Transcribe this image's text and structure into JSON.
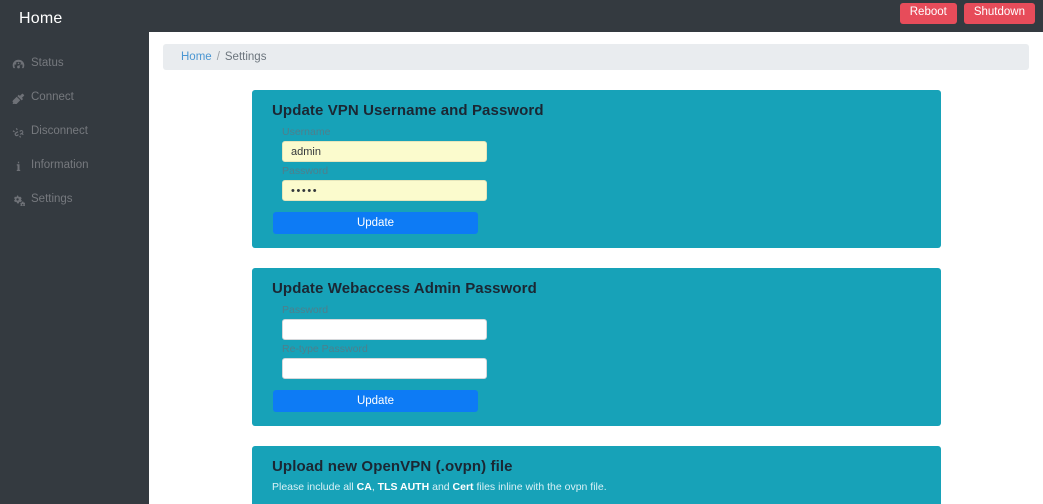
{
  "header": {
    "brand": "Home",
    "reboot_label": "Reboot",
    "shutdown_label": "Shutdown"
  },
  "sidebar": {
    "items": [
      {
        "label": "Status",
        "icon": "dashboard-icon"
      },
      {
        "label": "Connect",
        "icon": "plug-icon"
      },
      {
        "label": "Disconnect",
        "icon": "broken-chain-icon"
      },
      {
        "label": "Information",
        "icon": "info-icon"
      },
      {
        "label": "Settings",
        "icon": "gears-icon"
      }
    ]
  },
  "breadcrumb": {
    "home": "Home",
    "separator": "/",
    "current": "Settings"
  },
  "cards": [
    {
      "title": "Update VPN Username and Password",
      "fields": [
        {
          "label": "Username",
          "value": "admin",
          "placeholder": "",
          "autofill": true,
          "password": false
        },
        {
          "label": "Password",
          "value": "•••••",
          "placeholder": "",
          "autofill": true,
          "password": true
        }
      ],
      "button": "Update"
    },
    {
      "title": "Update Webaccess Admin Password",
      "fields": [
        {
          "label": "Password",
          "value": "",
          "placeholder": "",
          "autofill": false,
          "password": true
        },
        {
          "label": "Re-type Password",
          "value": "",
          "placeholder": "",
          "autofill": false,
          "password": true
        }
      ],
      "button": "Update"
    },
    {
      "title": "Upload new OpenVPN (.ovpn) file",
      "subtitle_parts": [
        {
          "text": "Please include all ",
          "bold": false
        },
        {
          "text": "CA",
          "bold": true
        },
        {
          "text": ", ",
          "bold": false
        },
        {
          "text": "TLS AUTH",
          "bold": true
        },
        {
          "text": " and ",
          "bold": false
        },
        {
          "text": "Cert",
          "bold": true
        },
        {
          "text": " files inline with the ovpn file.",
          "bold": false
        }
      ]
    }
  ],
  "colors": {
    "sidebar": "#343a40",
    "card": "#17a2b8",
    "primary": "#0d7bf5",
    "danger": "#e74c5a",
    "breadcrumb_bg": "#e9ecef",
    "link": "#4a96d2",
    "autofill": "#fbfbcd"
  }
}
